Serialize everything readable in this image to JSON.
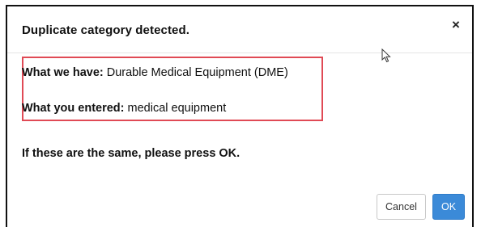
{
  "dialog": {
    "title": "Duplicate category detected.",
    "close_glyph": "×",
    "comparison": {
      "have_label": "What we have:",
      "have_value": "Durable Medical Equipment (DME)",
      "entered_label": "What you entered:",
      "entered_value": "medical equipment"
    },
    "confirm_message": "If these are the same, please press OK.",
    "buttons": {
      "cancel_label": "Cancel",
      "ok_label": "OK"
    }
  },
  "colors": {
    "highlight_border": "#e04a55",
    "primary_button": "#3b8ad8"
  },
  "icons": [
    "close-icon",
    "mouse-cursor-icon"
  ]
}
